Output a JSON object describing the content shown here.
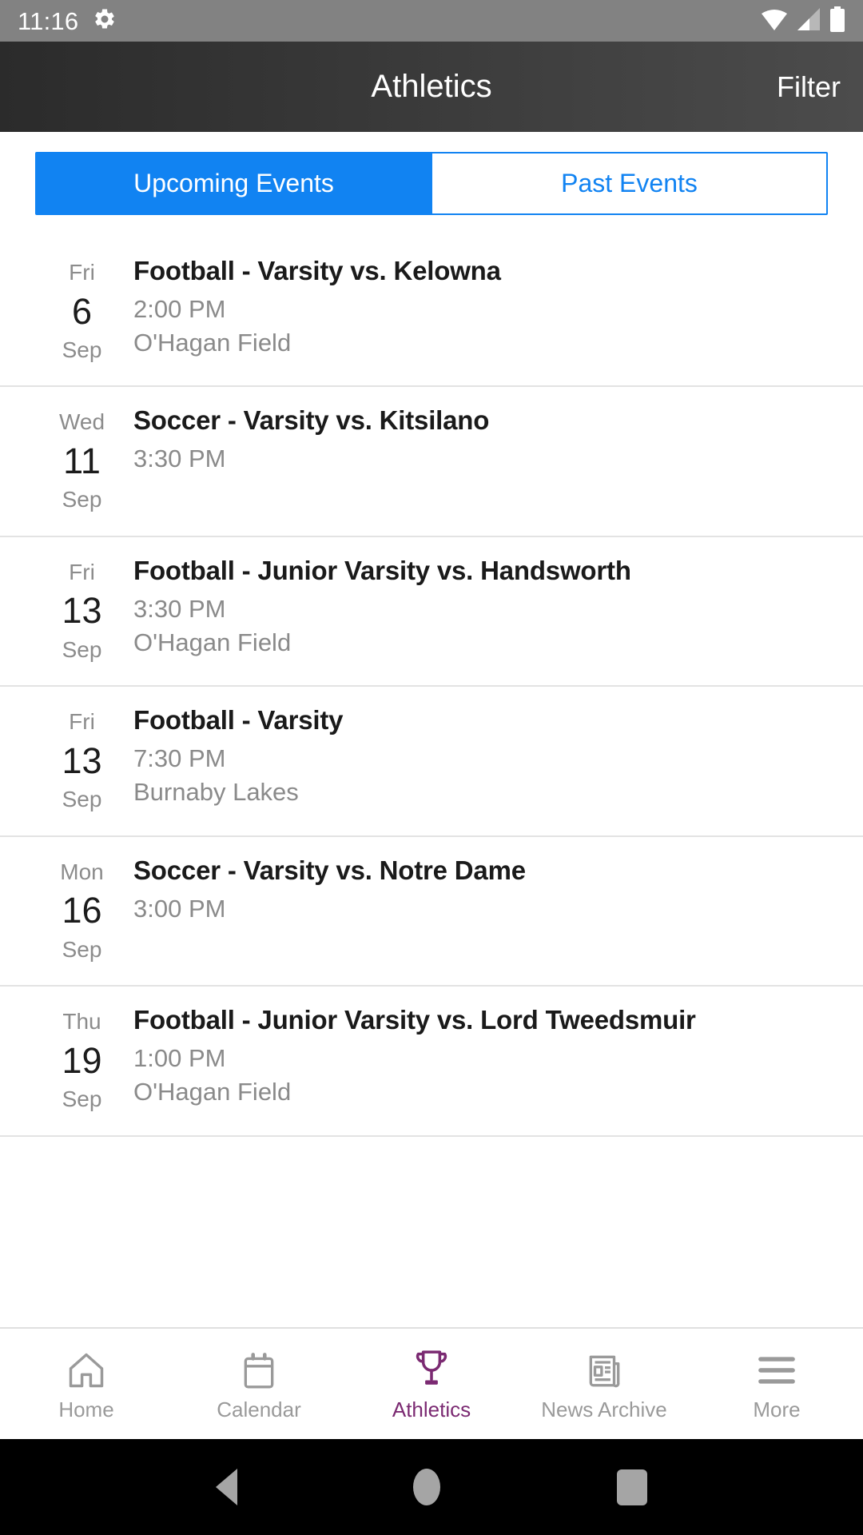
{
  "status_bar": {
    "time": "11:16",
    "icons": [
      "gear-icon",
      "wifi-icon",
      "cell-signal-icon",
      "battery-icon"
    ]
  },
  "app_bar": {
    "title": "Athletics",
    "action_label": "Filter"
  },
  "tabs": {
    "upcoming_label": "Upcoming Events",
    "past_label": "Past Events",
    "active": "upcoming",
    "accent_color": "#1183f2"
  },
  "events": [
    {
      "dow": "Fri",
      "day": "6",
      "month": "Sep",
      "title": "Football - Varsity  vs. Kelowna",
      "time": "2:00 PM",
      "location": "O'Hagan Field"
    },
    {
      "dow": "Wed",
      "day": "11",
      "month": "Sep",
      "title": "Soccer - Varsity  vs. Kitsilano",
      "time": "3:30 PM",
      "location": ""
    },
    {
      "dow": "Fri",
      "day": "13",
      "month": "Sep",
      "title": "Football - Junior Varsity  vs. Handsworth",
      "time": "3:30 PM",
      "location": "O'Hagan Field"
    },
    {
      "dow": "Fri",
      "day": "13",
      "month": "Sep",
      "title": "Football - Varsity",
      "time": "7:30 PM",
      "location": "Burnaby Lakes"
    },
    {
      "dow": "Mon",
      "day": "16",
      "month": "Sep",
      "title": "Soccer - Varsity  vs. Notre Dame",
      "time": "3:00 PM",
      "location": ""
    },
    {
      "dow": "Thu",
      "day": "19",
      "month": "Sep",
      "title": "Football - Junior Varsity  vs. Lord Tweedsmuir",
      "time": "1:00 PM",
      "location": "O'Hagan Field"
    }
  ],
  "bottom_nav": {
    "active_color": "#7b2a72",
    "inactive_color": "#9a9a9a",
    "items": [
      {
        "label": "Home",
        "icon": "home-icon",
        "active": false
      },
      {
        "label": "Calendar",
        "icon": "calendar-icon",
        "active": false
      },
      {
        "label": "Athletics",
        "icon": "trophy-icon",
        "active": true
      },
      {
        "label": "News Archive",
        "icon": "newspaper-icon",
        "active": false
      },
      {
        "label": "More",
        "icon": "hamburger-icon",
        "active": false
      }
    ]
  },
  "system_nav": {
    "back": "back-triangle-icon",
    "home": "home-circle-icon",
    "recents": "recents-square-icon"
  }
}
